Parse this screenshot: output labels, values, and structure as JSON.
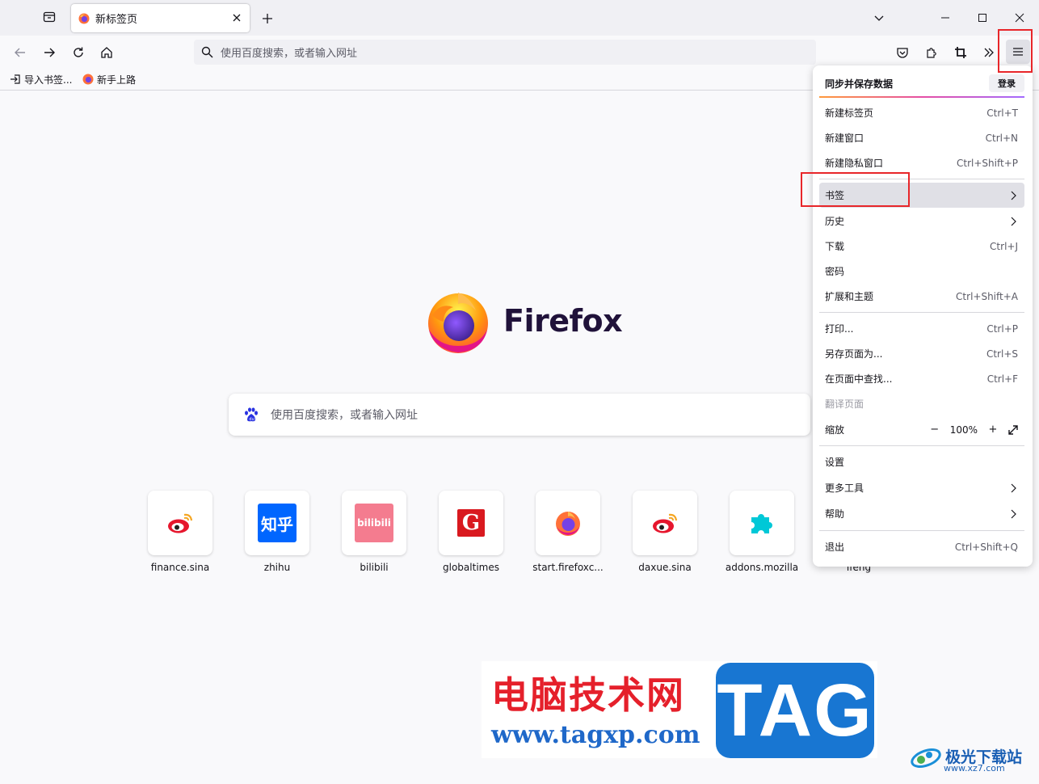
{
  "tab": {
    "title": "新标签页"
  },
  "urlbar": {
    "placeholder": "使用百度搜索，或者输入网址"
  },
  "bookmarks": [
    {
      "label": "导入书签..."
    },
    {
      "label": "新手上路"
    }
  ],
  "brand": {
    "name": "Firefox"
  },
  "content_search": {
    "placeholder": "使用百度搜索，或者输入网址"
  },
  "top_sites": [
    {
      "label": "finance.sina"
    },
    {
      "label": "zhihu",
      "icon_text": "知乎"
    },
    {
      "label": "bilibili",
      "icon_text": "bilibili"
    },
    {
      "label": "globaltimes",
      "icon_text": "G"
    },
    {
      "label": "start.firefoxc..."
    },
    {
      "label": "daxue.sina"
    },
    {
      "label": "addons.mozilla"
    },
    {
      "label": "ifeng"
    }
  ],
  "app_menu": {
    "sync_label": "同步并保存数据",
    "login_label": "登录",
    "items": [
      {
        "label": "新建标签页",
        "shortcut": "Ctrl+T"
      },
      {
        "label": "新建窗口",
        "shortcut": "Ctrl+N"
      },
      {
        "label": "新建隐私窗口",
        "shortcut": "Ctrl+Shift+P"
      },
      {
        "label": "书签",
        "shortcut": ""
      },
      {
        "label": "历史",
        "shortcut": ""
      },
      {
        "label": "下载",
        "shortcut": "Ctrl+J"
      },
      {
        "label": "密码",
        "shortcut": ""
      },
      {
        "label": "扩展和主题",
        "shortcut": "Ctrl+Shift+A"
      },
      {
        "label": "打印...",
        "shortcut": "Ctrl+P"
      },
      {
        "label": "另存页面为...",
        "shortcut": "Ctrl+S"
      },
      {
        "label": "在页面中查找...",
        "shortcut": "Ctrl+F"
      },
      {
        "label": "翻译页面",
        "shortcut": ""
      },
      {
        "label": "缩放",
        "shortcut": ""
      },
      {
        "label": "设置",
        "shortcut": ""
      },
      {
        "label": "更多工具",
        "shortcut": ""
      },
      {
        "label": "帮助",
        "shortcut": ""
      },
      {
        "label": "退出",
        "shortcut": "Ctrl+Shift+Q"
      }
    ],
    "zoom": {
      "minus": "−",
      "value": "100%",
      "plus": "+"
    }
  },
  "watermark": {
    "title": "电脑技术网",
    "url": "www.tagxp.com",
    "tag": "TAG",
    "site_name": "极光下载站",
    "site_url": "www.xz7.com"
  },
  "colors": {
    "highlight": "#e8262a",
    "accent": "#0060df"
  }
}
